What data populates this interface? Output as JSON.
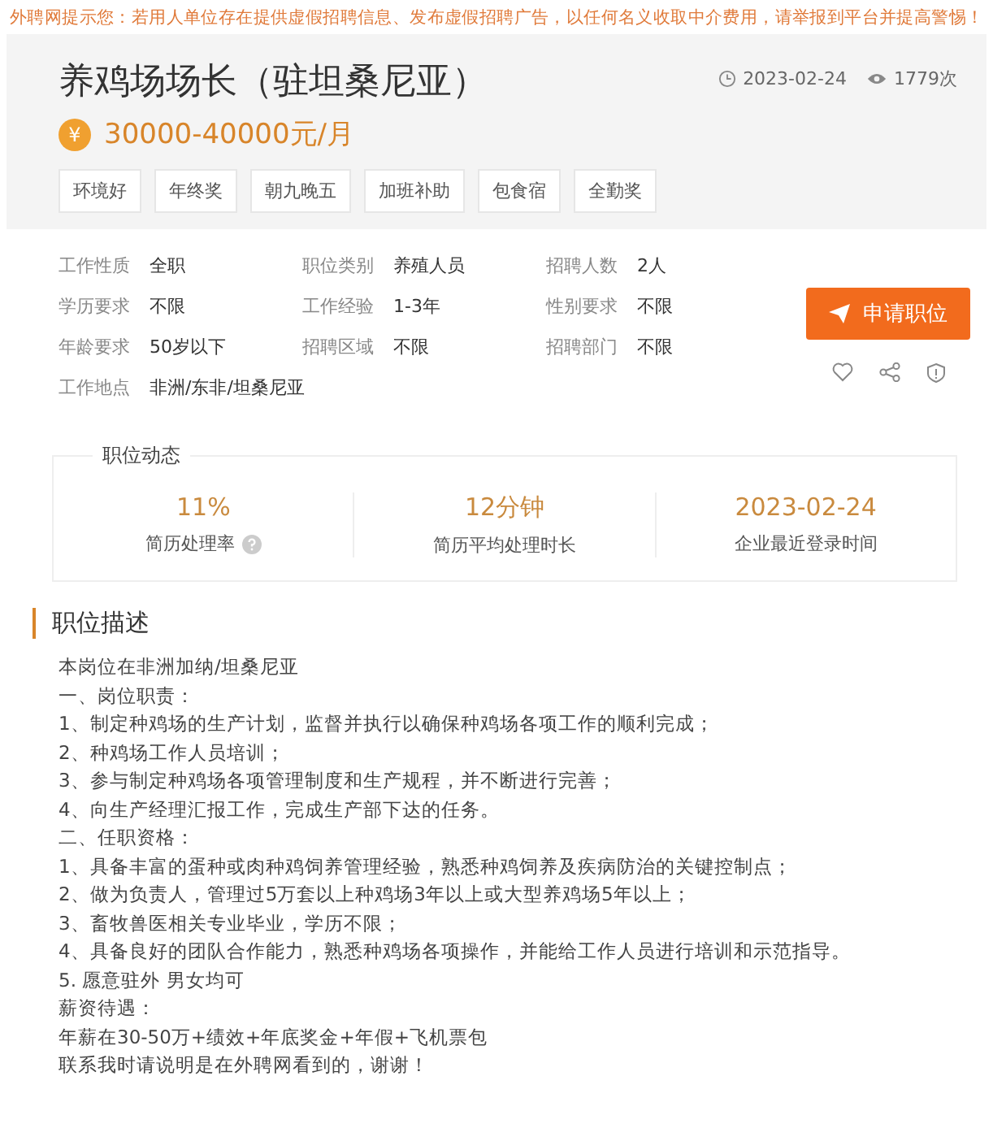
{
  "notice": "外聘网提示您：若用人单位存在提供虚假招聘信息、发布虚假招聘广告，以任何名义收取中介费用，请举报到平台并提高警惕！",
  "job": {
    "title": "养鸡场场长（驻坦桑尼亚）",
    "date": "2023-02-24",
    "views": "1779次",
    "currency_symbol": "¥",
    "salary": "30000-40000元/月",
    "tags": [
      "环境好",
      "年终奖",
      "朝九晚五",
      "加班补助",
      "包食宿",
      "全勤奖"
    ]
  },
  "details": [
    {
      "label": "工作性质",
      "value": "全职"
    },
    {
      "label": "职位类别",
      "value": "养殖人员"
    },
    {
      "label": "招聘人数",
      "value": "2人"
    },
    {
      "label": "学历要求",
      "value": "不限"
    },
    {
      "label": "工作经验",
      "value": "1-3年"
    },
    {
      "label": "性别要求",
      "value": "不限"
    },
    {
      "label": "年龄要求",
      "value": "50岁以下"
    },
    {
      "label": "招聘区域",
      "value": "不限"
    },
    {
      "label": "招聘部门",
      "value": "不限"
    },
    {
      "label": "工作地点",
      "value": "非洲/东非/坦桑尼亚"
    }
  ],
  "apply_button": "申请职位",
  "stats": {
    "title": "职位动态",
    "items": [
      {
        "value": "11%",
        "label": "简历处理率",
        "help": true
      },
      {
        "value": "12分钟",
        "label": "简历平均处理时长",
        "help": false
      },
      {
        "value": "2023-02-24",
        "label": "企业最近登录时间",
        "help": false
      }
    ]
  },
  "description": {
    "title": "职位描述",
    "lines": [
      "本岗位在非洲加纳/坦桑尼亚",
      "一、岗位职责：",
      "1、制定种鸡场的生产计划，监督并执行以确保种鸡场各项工作的顺利完成；",
      "2、种鸡场工作人员培训；",
      "3、参与制定种鸡场各项管理制度和生产规程，并不断进行完善；",
      "4、向生产经理汇报工作，完成生产部下达的任务。",
      "二、任职资格：",
      "1、具备丰富的蛋种或肉种鸡饲养管理经验，熟悉种鸡饲养及疾病防治的关键控制点；",
      "2、做为负责人，管理过5万套以上种鸡场3年以上或大型养鸡场5年以上；",
      "3、畜牧兽医相关专业毕业，学历不限；",
      "4、具备良好的团队合作能力，熟悉种鸡场各项操作，并能给工作人员进行培训和示范指导。",
      "5. 愿意驻外 男女均可",
      "薪资待遇：",
      "年薪在30-50万+绩效+年底奖金+年假+飞机票包",
      "联系我时请说明是在外聘网看到的，谢谢！"
    ]
  }
}
